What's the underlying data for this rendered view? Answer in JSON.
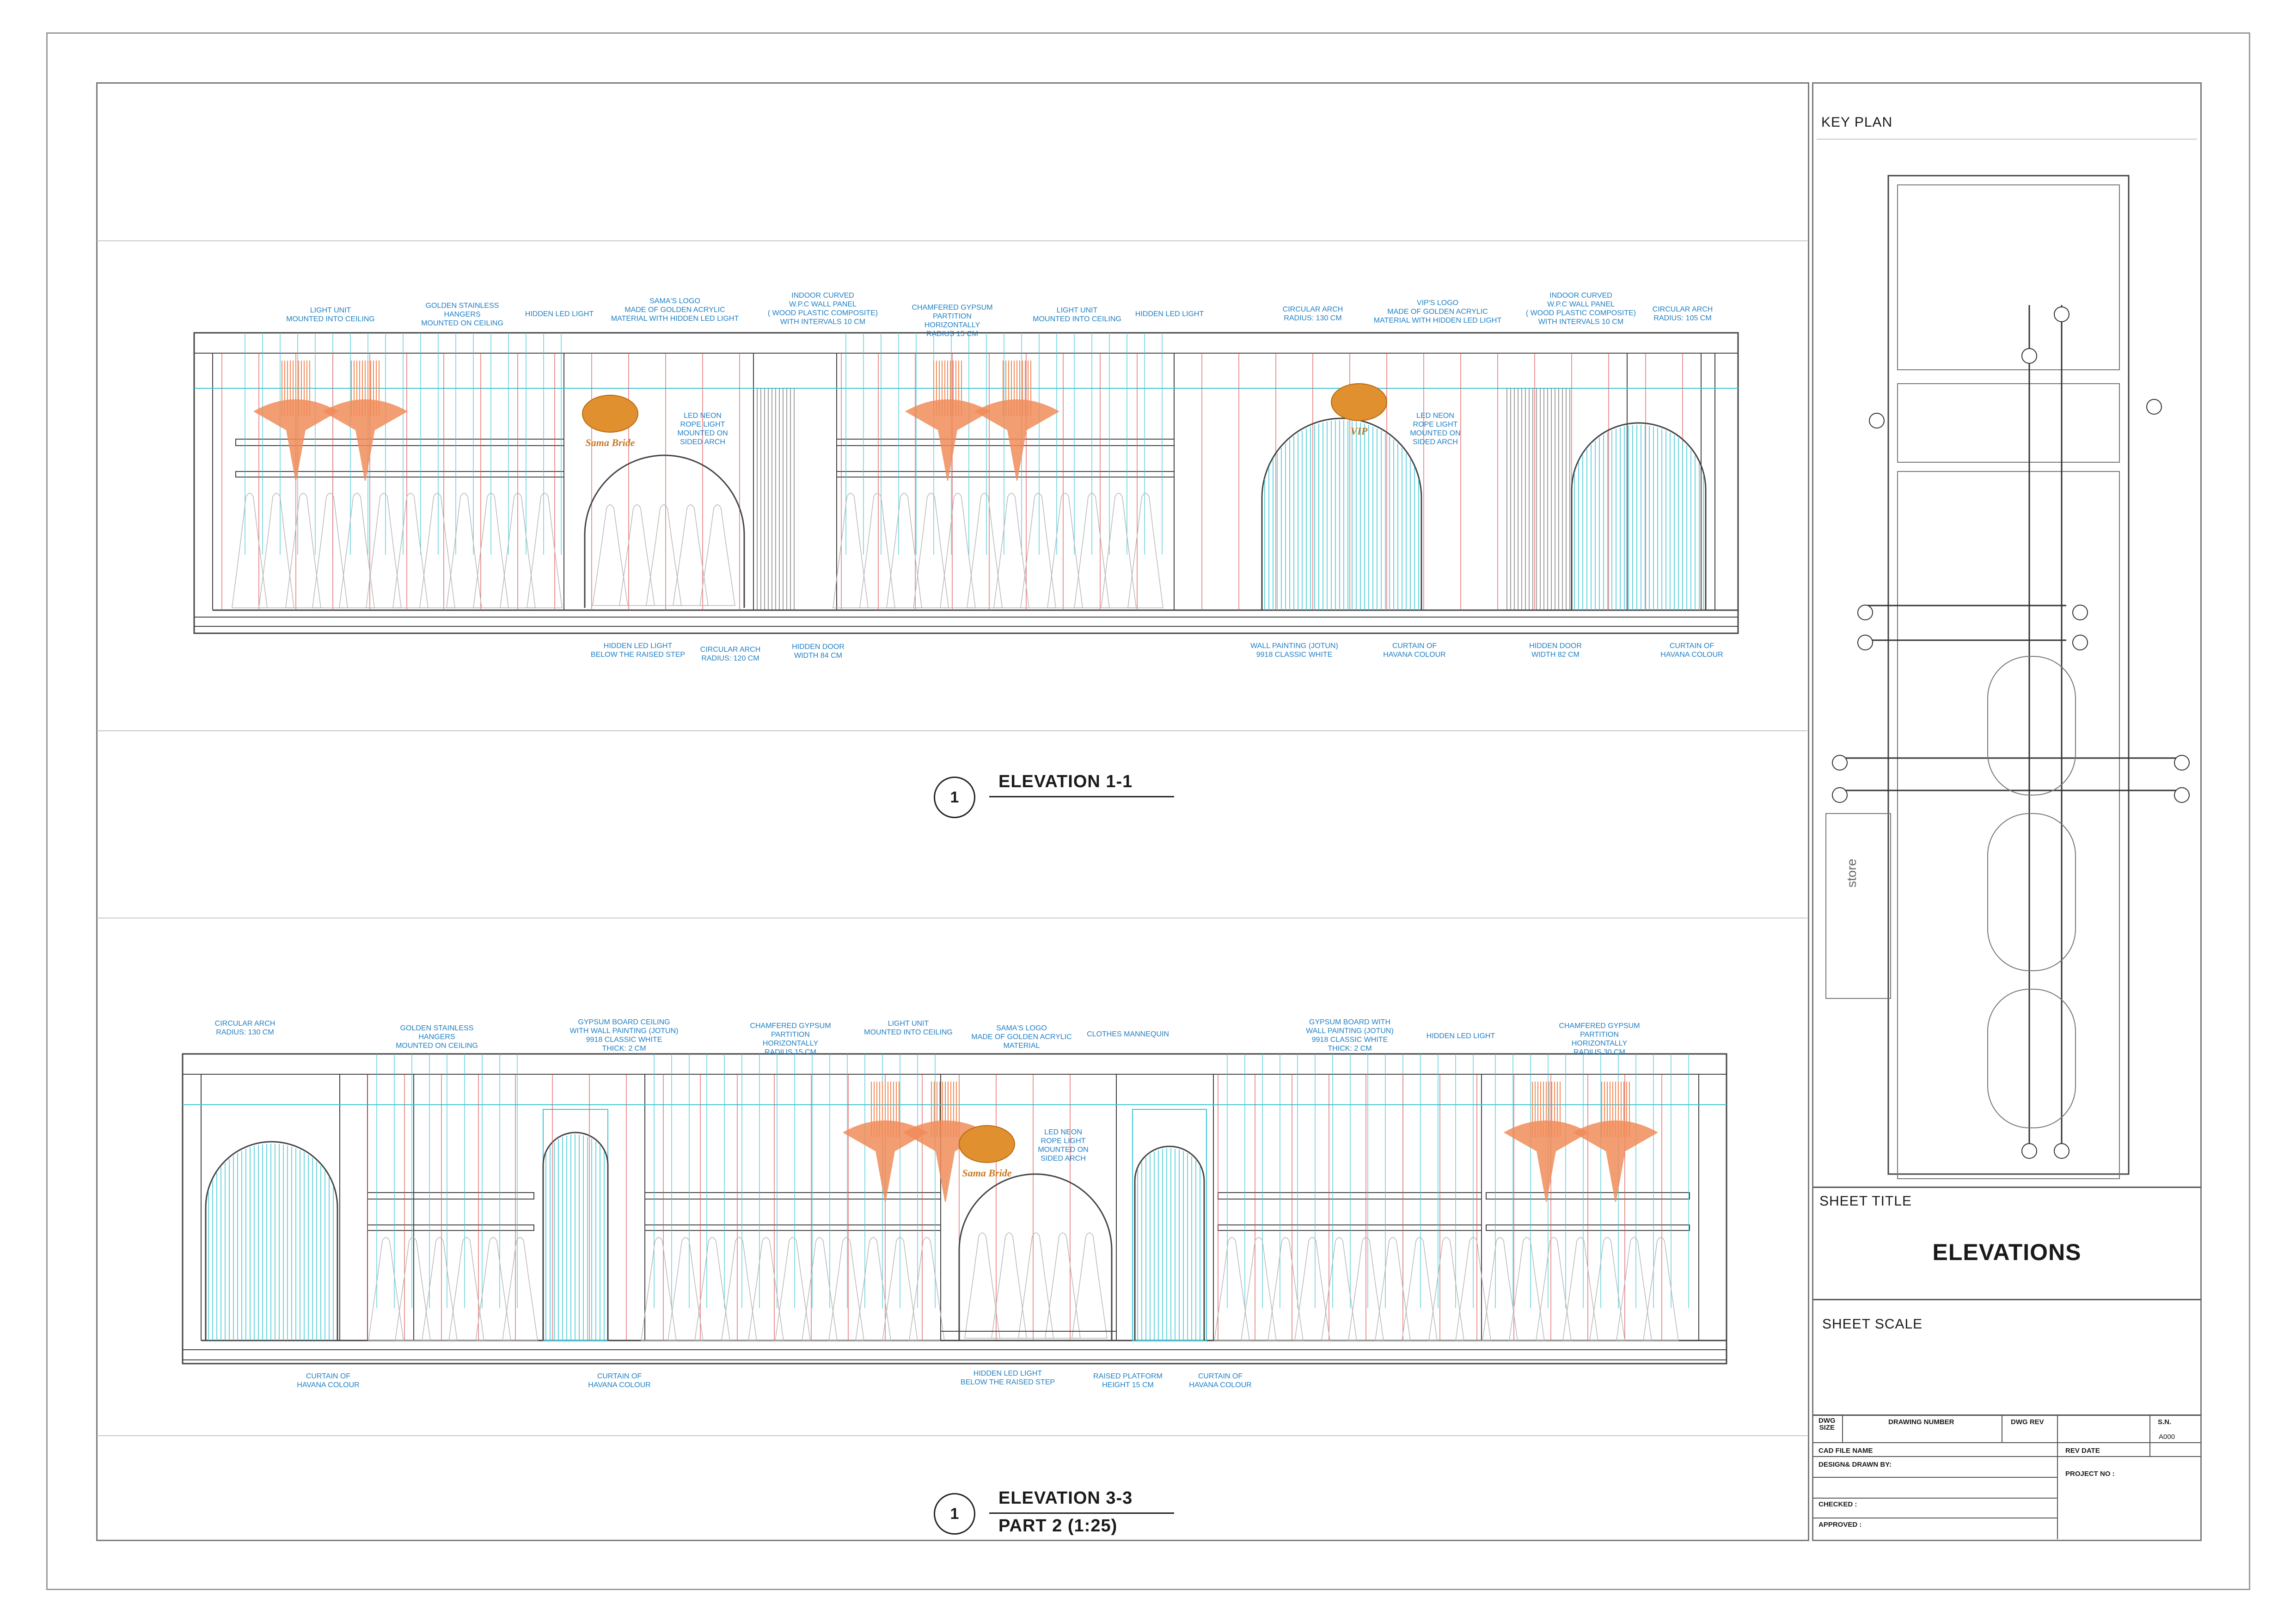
{
  "elevation_1": {
    "number": "1",
    "title": "ELEVATION 1-1",
    "notes_top": [
      "LIGHT UNIT\nMOUNTED INTO CEILING",
      "GOLDEN STAINLESS\nHANGERS\nMOUNTED ON CEILING",
      "HIDDEN LED LIGHT",
      "SAMA'S LOGO\nMADE OF GOLDEN ACRYLIC\nMATERIAL WITH HIDDEN LED LIGHT",
      "INDOOR CURVED\nW.P.C WALL PANEL\n( WOOD PLASTIC COMPOSITE)\nWITH INTERVALS 10 CM",
      "CHAMFERED GYPSUM PARTITION\nHORIZONTALLY\nRADIUS 15 CM",
      "LIGHT UNIT\nMOUNTED INTO CEILING",
      "HIDDEN LED LIGHT",
      "CIRCULAR ARCH\nRADIUS: 130 CM",
      "VIP'S LOGO\nMADE OF GOLDEN ACRYLIC\nMATERIAL WITH HIDDEN LED LIGHT",
      "INDOOR CURVED\nW.P.C WALL PANEL\n( WOOD PLASTIC COMPOSITE)\nWITH INTERVALS 10 CM",
      "CIRCULAR ARCH\nRADIUS: 105 CM"
    ],
    "notes_mid": [
      "LED NEON\nROPE LIGHT\nMOUNTED ON\nSIDED ARCH",
      "LED NEON\nROPE LIGHT\nMOUNTED ON\nSIDED ARCH"
    ],
    "notes_bottom": [
      "HIDDEN LED LIGHT\nBELOW THE RAISED STEP",
      "CIRCULAR ARCH\nRADIUS: 120 CM",
      "HIDDEN DOOR\nWIDTH 84 CM",
      "WALL PAINTING (JOTUN)\n9918 CLASSIC WHITE",
      "CURTAIN OF\nHAVANA COLOUR",
      "HIDDEN DOOR\nWIDTH 82 CM",
      "CURTAIN OF\nHAVANA COLOUR"
    ],
    "logos": [
      "Sama Bride",
      "VIP"
    ]
  },
  "elevation_3": {
    "number": "1",
    "title": "ELEVATION 3-3",
    "subtitle": "PART 2 (1:25)",
    "notes_top": [
      "CIRCULAR ARCH\nRADIUS: 130 CM",
      "GOLDEN STAINLESS\nHANGERS\nMOUNTED ON CEILING",
      "GYPSUM BOARD CEILING\nWITH WALL PAINTING (JOTUN)\n9918 CLASSIC WHITE\nTHICK: 2 CM",
      "CHAMFERED GYPSUM PARTITION\nHORIZONTALLY\nRADIUS 15 CM",
      "LIGHT UNIT\nMOUNTED INTO CEILING",
      "SAMA'S LOGO\nMADE OF GOLDEN ACRYLIC\nMATERIAL",
      "CLOTHES MANNEQUIN",
      "GYPSUM BOARD WITH\nWALL PAINTING (JOTUN)\n9918 CLASSIC WHITE\nTHICK: 2 CM",
      "HIDDEN LED LIGHT",
      "CHAMFERED GYPSUM PARTITION\nHORIZONTALLY\nRADIUS 30 CM"
    ],
    "notes_mid": [
      "LED NEON\nROPE LIGHT\nMOUNTED ON\nSIDED ARCH"
    ],
    "notes_bottom": [
      "CURTAIN OF\nHAVANA COLOUR",
      "CURTAIN OF\nHAVANA COLOUR",
      "HIDDEN LED LIGHT\nBELOW THE RAISED STEP",
      "RAISED PLATFORM\nHEIGHT 15 CM",
      "CURTAIN OF\nHAVANA COLOUR"
    ],
    "logos": [
      "Sama Bride"
    ]
  },
  "side_panel": {
    "key_plan_label": "KEY PLAN",
    "store_label": "store",
    "sheet_title_label": "SHEET TITLE",
    "sheet_title_value": "ELEVATIONS",
    "sheet_scale_label": "SHEET SCALE"
  },
  "title_block": {
    "dwg_size": "DWG\nSIZE",
    "drawing_number": "DRAWING NUMBER",
    "dwg_rev": "DWG REV",
    "sn": "S.N.",
    "sn_value": "A000",
    "cad_file_name": "CAD FILE NAME",
    "rev_date": "REV DATE",
    "design_drawn_by": "DESIGN& DRAWN BY:",
    "project_no": "PROJECT NO :",
    "checked": "CHECKED :",
    "approved": "APPROVED :"
  },
  "colors": {
    "annotation": "#1e7fc4",
    "curtain": "#3cc6d6",
    "chandelier": "#f08c5a",
    "dimension": "#e05050",
    "line": "#444444"
  }
}
